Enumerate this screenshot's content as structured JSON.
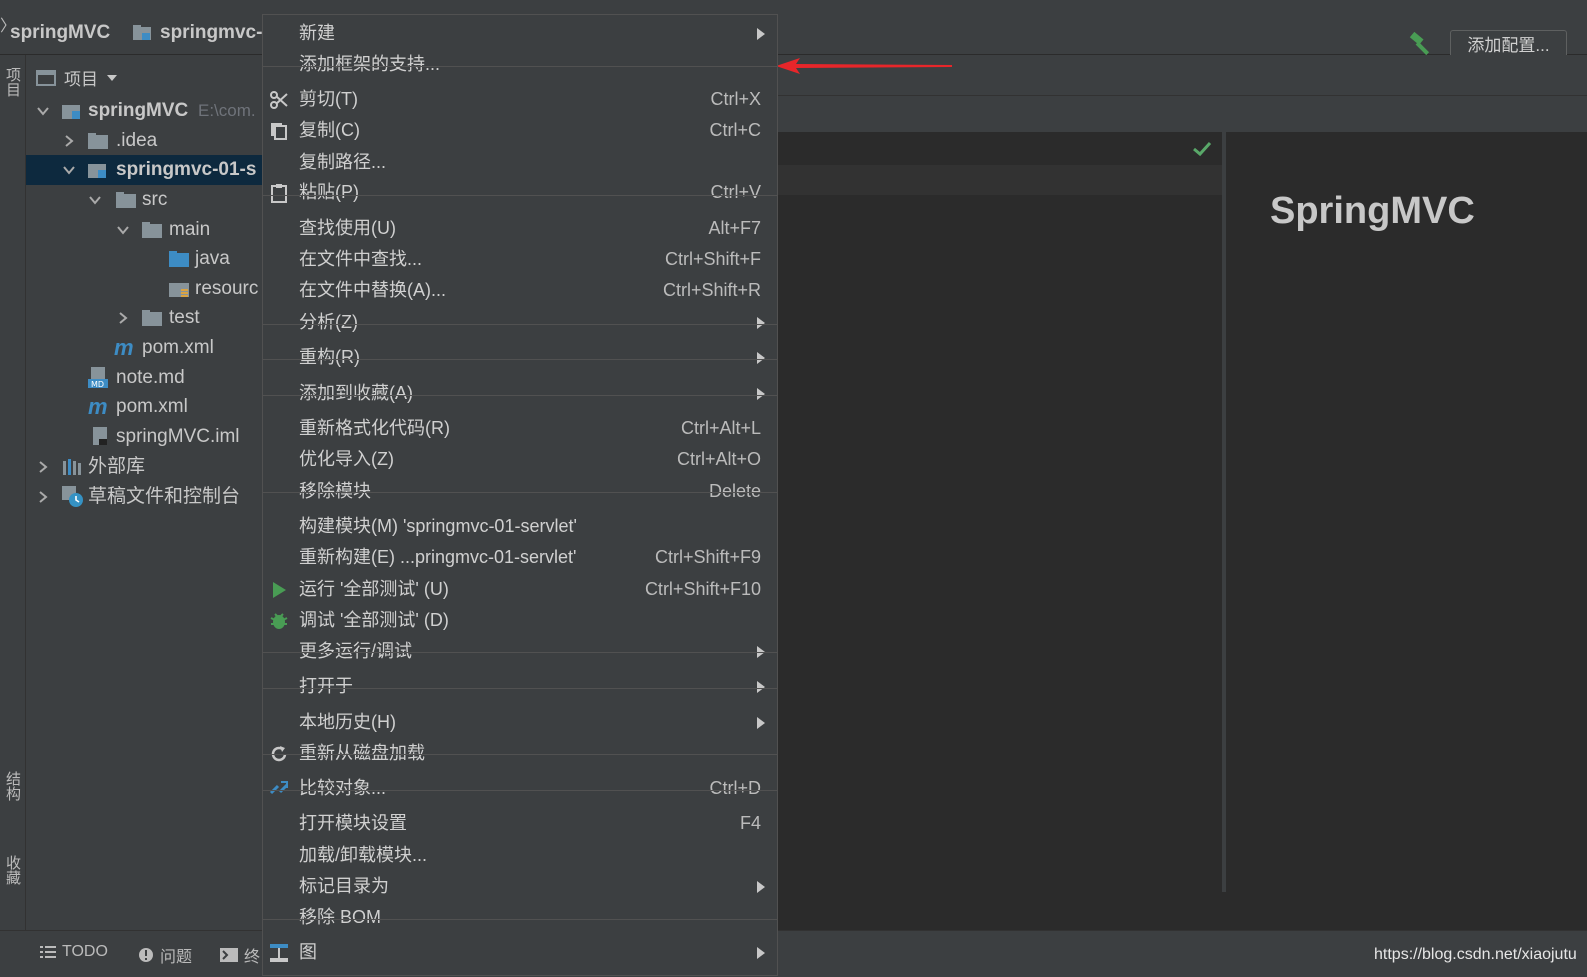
{
  "navbar": {
    "project": "springMVC",
    "module": "springmvc-",
    "add_config": "添加配置..."
  },
  "side_tabs": {
    "project": "项目",
    "structure": "结构",
    "favorites": "收藏"
  },
  "project_panel": {
    "header": "项目",
    "tree": [
      {
        "label": "springMVC",
        "hint": "E:\\com.",
        "bold": true
      },
      {
        "label": ".idea"
      },
      {
        "label": "springmvc-01-s",
        "bold": true
      },
      {
        "label": "src"
      },
      {
        "label": "main"
      },
      {
        "label": "java"
      },
      {
        "label": "resourc"
      },
      {
        "label": "test"
      },
      {
        "label": "pom.xml"
      },
      {
        "label": "note.md"
      },
      {
        "label": "pom.xml"
      },
      {
        "label": "springMVC.iml"
      },
      {
        "label": "外部库"
      },
      {
        "label": "草稿文件和控制台"
      }
    ]
  },
  "editor": {
    "preview_title": "SpringMVC"
  },
  "bottombar": {
    "todo": "TODO",
    "problems": "问题",
    "terminal": "终",
    "watermark": "https://blog.csdn.net/xiaojutu"
  },
  "context_menu": {
    "items": [
      {
        "label": "新建",
        "shortcut": "",
        "submenu": true
      },
      {
        "label": "添加框架的支持...",
        "shortcut": ""
      },
      {
        "label": "剪切(T)",
        "shortcut": "Ctrl+X",
        "icon": "scissors-icon"
      },
      {
        "label": "复制(C)",
        "shortcut": "Ctrl+C",
        "icon": "copy-icon"
      },
      {
        "label": "复制路径...",
        "shortcut": ""
      },
      {
        "label": "粘贴(P)",
        "shortcut": "Ctrl+V",
        "icon": "paste-icon"
      },
      {
        "label": "查找使用(U)",
        "shortcut": "Alt+F7"
      },
      {
        "label": "在文件中查找...",
        "shortcut": "Ctrl+Shift+F"
      },
      {
        "label": "在文件中替换(A)...",
        "shortcut": "Ctrl+Shift+R"
      },
      {
        "label": "分析(Z)",
        "shortcut": "",
        "submenu": true
      },
      {
        "label": "重构(R)",
        "shortcut": "",
        "submenu": true
      },
      {
        "label": "添加到收藏(A)",
        "shortcut": "",
        "submenu": true
      },
      {
        "label": "重新格式化代码(R)",
        "shortcut": "Ctrl+Alt+L"
      },
      {
        "label": "优化导入(Z)",
        "shortcut": "Ctrl+Alt+O"
      },
      {
        "label": "移除模块",
        "shortcut": "Delete"
      },
      {
        "label": "构建模块(M) 'springmvc-01-servlet'",
        "shortcut": ""
      },
      {
        "label": "重新构建(E) ...pringmvc-01-servlet'",
        "shortcut": "Ctrl+Shift+F9"
      },
      {
        "label": "运行 '全部测试' (U)",
        "shortcut": "Ctrl+Shift+F10",
        "icon": "run-icon"
      },
      {
        "label": "调试 '全部测试' (D)",
        "shortcut": "",
        "icon": "debug-icon"
      },
      {
        "label": "更多运行/调试",
        "shortcut": "",
        "submenu": true
      },
      {
        "label": "打开于",
        "shortcut": "",
        "submenu": true
      },
      {
        "label": "本地历史(H)",
        "shortcut": "",
        "submenu": true
      },
      {
        "label": "重新从磁盘加载",
        "shortcut": "",
        "icon": "reload-icon"
      },
      {
        "label": "比较对象...",
        "shortcut": "Ctrl+D",
        "icon": "compare-icon"
      },
      {
        "label": "打开模块设置",
        "shortcut": "F4"
      },
      {
        "label": "加载/卸载模块...",
        "shortcut": ""
      },
      {
        "label": "标记目录为",
        "shortcut": "",
        "submenu": true
      },
      {
        "label": "移除 BOM",
        "shortcut": ""
      },
      {
        "label": "图",
        "shortcut": "",
        "submenu": true,
        "icon": "diagram-icon"
      }
    ]
  }
}
